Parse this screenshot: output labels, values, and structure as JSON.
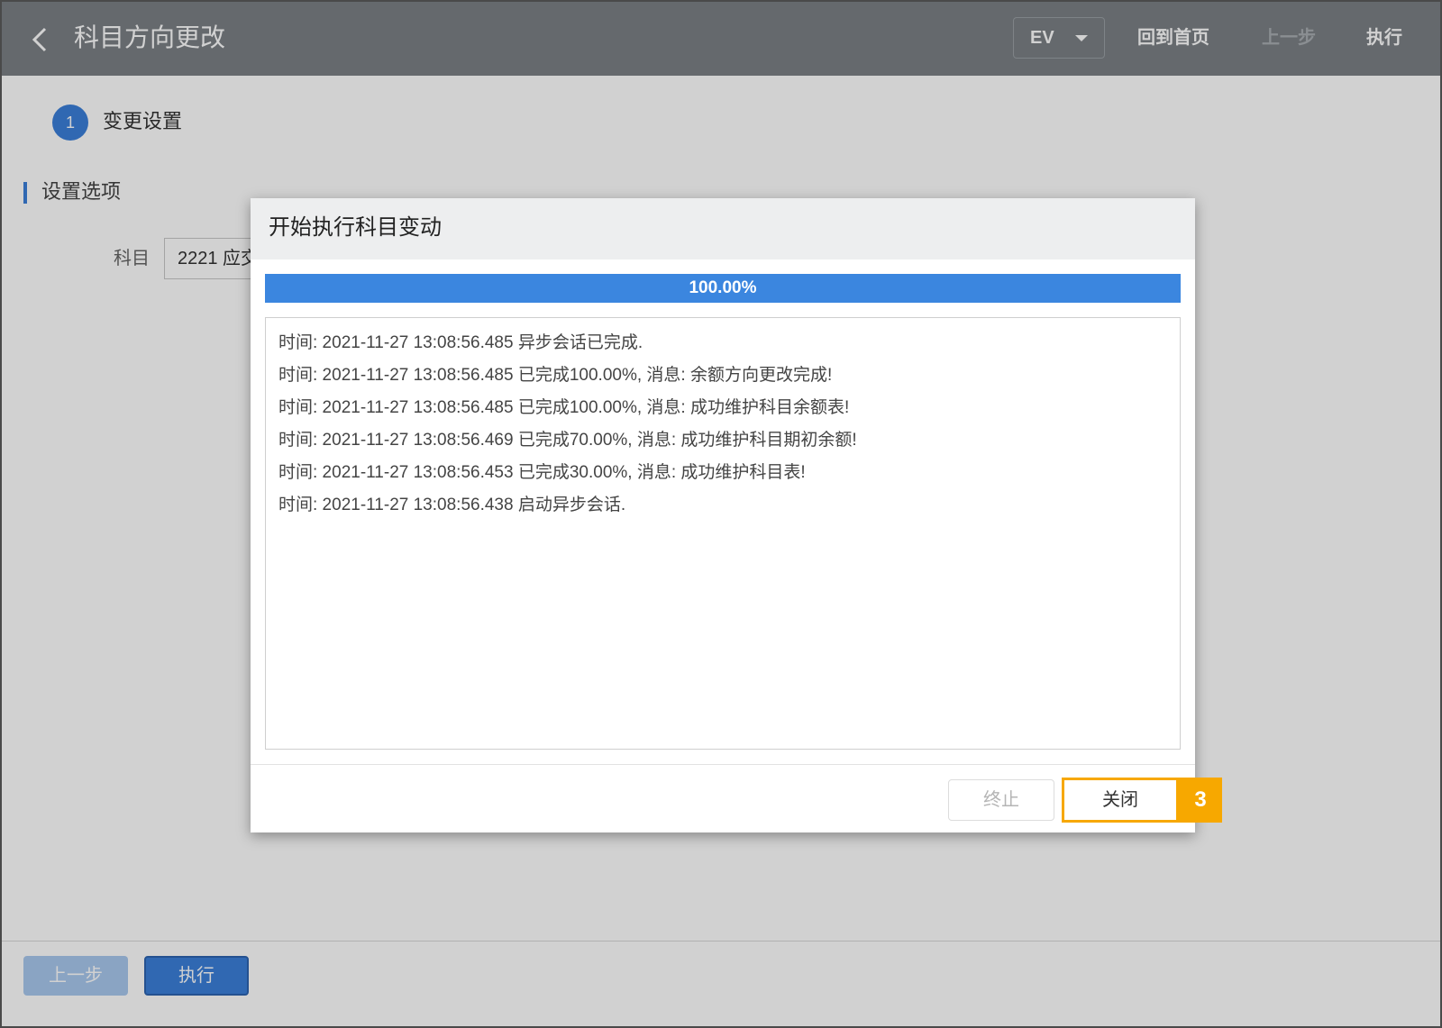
{
  "header": {
    "title": "科目方向更改",
    "ev_select": "EV",
    "home_link": "回到首页",
    "prev_link": "上一步",
    "exec_link": "执行"
  },
  "content": {
    "step_number": "1",
    "step_label": "变更设置",
    "section_title": "设置选项",
    "subject_label": "科目",
    "subject_value": "2221 应交"
  },
  "footer": {
    "prev_button": "上一步",
    "exec_button": "执行"
  },
  "modal": {
    "title": "开始执行科目变动",
    "progress_percent": 100,
    "progress_text": "100.00%",
    "log_lines": [
      "时间: 2021-11-27 13:08:56.485 异步会话已完成.",
      "时间: 2021-11-27 13:08:56.485 已完成100.00%, 消息: 余额方向更改完成!",
      "时间: 2021-11-27 13:08:56.485 已完成100.00%, 消息: 成功维护科目余额表!",
      "时间: 2021-11-27 13:08:56.469 已完成70.00%, 消息: 成功维护科目期初余额!",
      "时间: 2021-11-27 13:08:56.453 已完成30.00%, 消息: 成功维护科目表!",
      "时间: 2021-11-27 13:08:56.438 启动异步会话."
    ],
    "stop_button": "终止",
    "close_button": "关闭",
    "step_badge": "3"
  },
  "colors": {
    "header_bg": "#7c8186",
    "accent_blue": "#3b86df",
    "highlight_orange": "#f7a800"
  }
}
